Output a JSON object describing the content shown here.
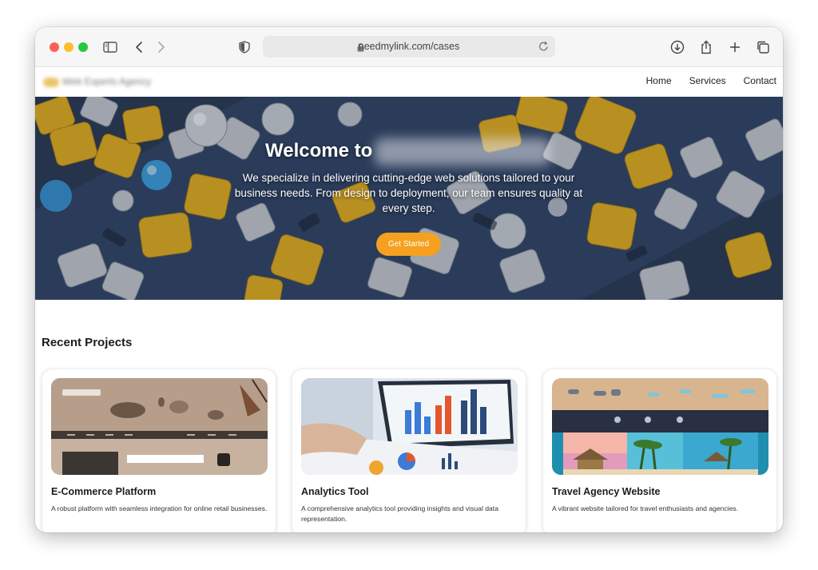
{
  "browser": {
    "url": "needmylink.com/cases",
    "icons": [
      "sidebar-icon",
      "back-icon",
      "forward-icon",
      "shield-icon",
      "lock-icon",
      "reload-icon",
      "download-icon",
      "share-icon",
      "new-tab-icon",
      "tabs-overview-icon"
    ]
  },
  "site": {
    "logo_text": "Web Experts Agency",
    "nav": {
      "home": "Home",
      "services": "Services",
      "contact": "Contact"
    }
  },
  "hero": {
    "title": "Welcome to",
    "text": "We specialize in delivering cutting-edge web solutions tailored to your business needs. From design to deployment, our team ensures quality at every step.",
    "button": "Get Started",
    "accent_color": "#f5a01f"
  },
  "projects": {
    "heading": "Recent Projects",
    "items": [
      {
        "title": "E-Commerce Platform",
        "desc": "A robust platform with seamless integration for online retail businesses."
      },
      {
        "title": "Analytics Tool",
        "desc": "A comprehensive analytics tool providing insights and visual data representation."
      },
      {
        "title": "Travel Agency Website",
        "desc": "A vibrant website tailored for travel enthusiasts and agencies."
      }
    ]
  }
}
